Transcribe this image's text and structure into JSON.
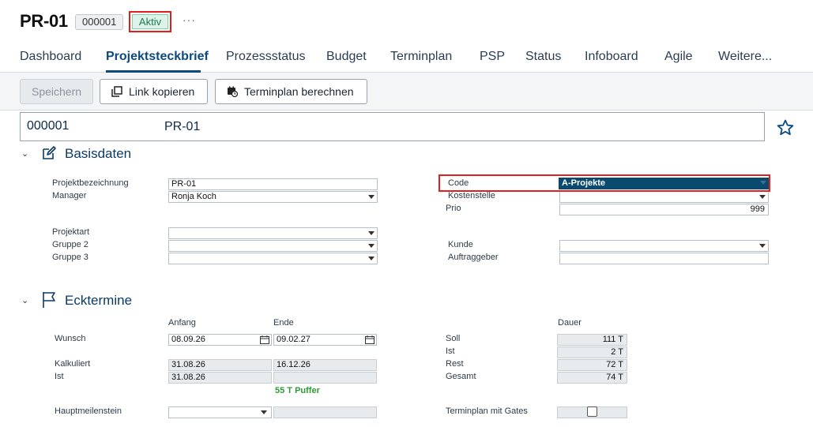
{
  "header": {
    "title": "PR-01",
    "id_badge": "000001",
    "status": "Aktiv",
    "more": "···"
  },
  "tabs": [
    "Dashboard",
    "Projektsteckbrief",
    "Prozessstatus",
    "Budget",
    "Terminplan",
    "PSP",
    "Status",
    "Infoboard",
    "Agile",
    "Weitere..."
  ],
  "active_tab": "Projektsteckbrief",
  "toolbar": {
    "save": "Speichern",
    "copy_link": "Link kopieren",
    "calc_schedule": "Terminplan berechnen"
  },
  "project_header": {
    "number": "000001",
    "name": "PR-01"
  },
  "basisdaten": {
    "title": "Basisdaten",
    "projektbezeichnung": {
      "label": "Projektbezeichnung",
      "value": "PR-01"
    },
    "manager": {
      "label": "Manager",
      "value": "Ronja Koch"
    },
    "projektart": {
      "label": "Projektart",
      "value": ""
    },
    "gruppe2": {
      "label": "Gruppe 2",
      "value": ""
    },
    "gruppe3": {
      "label": "Gruppe 3",
      "value": ""
    },
    "code": {
      "label": "Code",
      "value": "A-Projekte"
    },
    "kostenstelle": {
      "label": "Kostenstelle",
      "value": ""
    },
    "prio": {
      "label": "Prio",
      "value": "999"
    },
    "kunde": {
      "label": "Kunde",
      "value": ""
    },
    "auftraggeber": {
      "label": "Auftraggeber",
      "value": ""
    }
  },
  "ecktermine": {
    "title": "Ecktermine",
    "col_anfang": "Anfang",
    "col_ende": "Ende",
    "col_dauer": "Dauer",
    "wunsch": {
      "label": "Wunsch",
      "anfang": "08.09.26",
      "ende": "09.02.27"
    },
    "kalkuliert": {
      "label": "Kalkuliert",
      "anfang": "31.08.26",
      "ende": "16.12.26"
    },
    "ist": {
      "label": "Ist",
      "anfang": "31.08.26",
      "ende": ""
    },
    "puffer": "55 T Puffer",
    "hauptmeilenstein": {
      "label": "Hauptmeilenstein",
      "value": ""
    },
    "soll": {
      "label": "Soll",
      "value": "111 T"
    },
    "ist_dauer": {
      "label": "Ist",
      "value": "2 T"
    },
    "rest": {
      "label": "Rest",
      "value": "72 T"
    },
    "gesamt": {
      "label": "Gesamt",
      "value": "74 T"
    },
    "terminplan_gates": {
      "label": "Terminplan mit Gates",
      "checked": false
    }
  },
  "colors": {
    "accent": "#0b4a80",
    "highlight": "#e0201d",
    "status_green": "#1f7a53",
    "code_bg": "#0b4a6f"
  },
  "icons": {
    "copy": "copy-icon",
    "calendar_clock": "calendar-clock-icon",
    "star": "star-icon",
    "edit": "edit-icon",
    "flag": "flag-icon"
  }
}
